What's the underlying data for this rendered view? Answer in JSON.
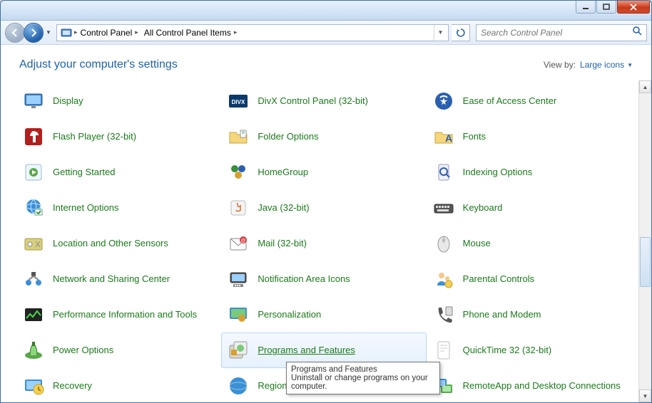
{
  "breadcrumb": {
    "seg1": "Control Panel",
    "seg2": "All Control Panel Items"
  },
  "search": {
    "placeholder": "Search Control Panel"
  },
  "header": {
    "title": "Adjust your computer's settings",
    "viewby_label": "View by:",
    "viewby_value": "Large icons"
  },
  "items": [
    {
      "label": "Display",
      "icon": "display"
    },
    {
      "label": "DivX Control Panel (32-bit)",
      "icon": "divx"
    },
    {
      "label": "Ease of Access Center",
      "icon": "ease"
    },
    {
      "label": "Flash Player (32-bit)",
      "icon": "flash"
    },
    {
      "label": "Folder Options",
      "icon": "folder"
    },
    {
      "label": "Fonts",
      "icon": "fonts"
    },
    {
      "label": "Getting Started",
      "icon": "start"
    },
    {
      "label": "HomeGroup",
      "icon": "homegroup"
    },
    {
      "label": "Indexing Options",
      "icon": "index"
    },
    {
      "label": "Internet Options",
      "icon": "internet"
    },
    {
      "label": "Java (32-bit)",
      "icon": "java"
    },
    {
      "label": "Keyboard",
      "icon": "keyboard"
    },
    {
      "label": "Location and Other Sensors",
      "icon": "location"
    },
    {
      "label": "Mail (32-bit)",
      "icon": "mail"
    },
    {
      "label": "Mouse",
      "icon": "mouse"
    },
    {
      "label": "Network and Sharing Center",
      "icon": "network"
    },
    {
      "label": "Notification Area Icons",
      "icon": "notif"
    },
    {
      "label": "Parental Controls",
      "icon": "parental"
    },
    {
      "label": "Performance Information and Tools",
      "icon": "perf"
    },
    {
      "label": "Personalization",
      "icon": "personal"
    },
    {
      "label": "Phone and Modem",
      "icon": "phone"
    },
    {
      "label": "Power Options",
      "icon": "power"
    },
    {
      "label": "Programs and Features",
      "icon": "programs"
    },
    {
      "label": "QuickTime 32 (32-bit)",
      "icon": "qt"
    },
    {
      "label": "Recovery",
      "icon": "recovery"
    },
    {
      "label": "Region and Language",
      "icon": "region"
    },
    {
      "label": "RemoteApp and Desktop Connections",
      "icon": "remote"
    }
  ],
  "hover_index": 22,
  "tooltip": {
    "title": "Programs and Features",
    "body": "Uninstall or change programs on your computer."
  }
}
